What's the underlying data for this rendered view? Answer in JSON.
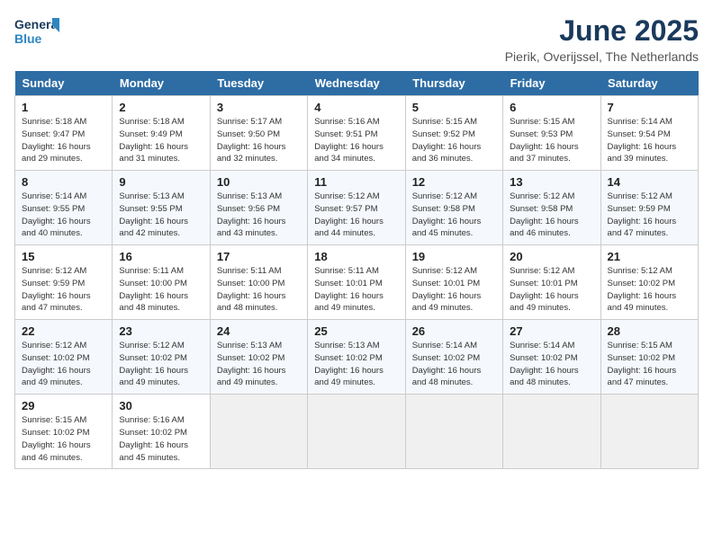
{
  "logo": {
    "line1": "General",
    "line2": "Blue"
  },
  "title": "June 2025",
  "subtitle": "Pierik, Overijssel, The Netherlands",
  "days_header": [
    "Sunday",
    "Monday",
    "Tuesday",
    "Wednesday",
    "Thursday",
    "Friday",
    "Saturday"
  ],
  "weeks": [
    [
      {
        "day": "1",
        "sunrise": "5:18 AM",
        "sunset": "9:47 PM",
        "daylight": "16 hours and 29 minutes."
      },
      {
        "day": "2",
        "sunrise": "5:18 AM",
        "sunset": "9:49 PM",
        "daylight": "16 hours and 31 minutes."
      },
      {
        "day": "3",
        "sunrise": "5:17 AM",
        "sunset": "9:50 PM",
        "daylight": "16 hours and 32 minutes."
      },
      {
        "day": "4",
        "sunrise": "5:16 AM",
        "sunset": "9:51 PM",
        "daylight": "16 hours and 34 minutes."
      },
      {
        "day": "5",
        "sunrise": "5:15 AM",
        "sunset": "9:52 PM",
        "daylight": "16 hours and 36 minutes."
      },
      {
        "day": "6",
        "sunrise": "5:15 AM",
        "sunset": "9:53 PM",
        "daylight": "16 hours and 37 minutes."
      },
      {
        "day": "7",
        "sunrise": "5:14 AM",
        "sunset": "9:54 PM",
        "daylight": "16 hours and 39 minutes."
      }
    ],
    [
      {
        "day": "8",
        "sunrise": "5:14 AM",
        "sunset": "9:55 PM",
        "daylight": "16 hours and 40 minutes."
      },
      {
        "day": "9",
        "sunrise": "5:13 AM",
        "sunset": "9:55 PM",
        "daylight": "16 hours and 42 minutes."
      },
      {
        "day": "10",
        "sunrise": "5:13 AM",
        "sunset": "9:56 PM",
        "daylight": "16 hours and 43 minutes."
      },
      {
        "day": "11",
        "sunrise": "5:12 AM",
        "sunset": "9:57 PM",
        "daylight": "16 hours and 44 minutes."
      },
      {
        "day": "12",
        "sunrise": "5:12 AM",
        "sunset": "9:58 PM",
        "daylight": "16 hours and 45 minutes."
      },
      {
        "day": "13",
        "sunrise": "5:12 AM",
        "sunset": "9:58 PM",
        "daylight": "16 hours and 46 minutes."
      },
      {
        "day": "14",
        "sunrise": "5:12 AM",
        "sunset": "9:59 PM",
        "daylight": "16 hours and 47 minutes."
      }
    ],
    [
      {
        "day": "15",
        "sunrise": "5:12 AM",
        "sunset": "9:59 PM",
        "daylight": "16 hours and 47 minutes."
      },
      {
        "day": "16",
        "sunrise": "5:11 AM",
        "sunset": "10:00 PM",
        "daylight": "16 hours and 48 minutes."
      },
      {
        "day": "17",
        "sunrise": "5:11 AM",
        "sunset": "10:00 PM",
        "daylight": "16 hours and 48 minutes."
      },
      {
        "day": "18",
        "sunrise": "5:11 AM",
        "sunset": "10:01 PM",
        "daylight": "16 hours and 49 minutes."
      },
      {
        "day": "19",
        "sunrise": "5:12 AM",
        "sunset": "10:01 PM",
        "daylight": "16 hours and 49 minutes."
      },
      {
        "day": "20",
        "sunrise": "5:12 AM",
        "sunset": "10:01 PM",
        "daylight": "16 hours and 49 minutes."
      },
      {
        "day": "21",
        "sunrise": "5:12 AM",
        "sunset": "10:02 PM",
        "daylight": "16 hours and 49 minutes."
      }
    ],
    [
      {
        "day": "22",
        "sunrise": "5:12 AM",
        "sunset": "10:02 PM",
        "daylight": "16 hours and 49 minutes."
      },
      {
        "day": "23",
        "sunrise": "5:12 AM",
        "sunset": "10:02 PM",
        "daylight": "16 hours and 49 minutes."
      },
      {
        "day": "24",
        "sunrise": "5:13 AM",
        "sunset": "10:02 PM",
        "daylight": "16 hours and 49 minutes."
      },
      {
        "day": "25",
        "sunrise": "5:13 AM",
        "sunset": "10:02 PM",
        "daylight": "16 hours and 49 minutes."
      },
      {
        "day": "26",
        "sunrise": "5:14 AM",
        "sunset": "10:02 PM",
        "daylight": "16 hours and 48 minutes."
      },
      {
        "day": "27",
        "sunrise": "5:14 AM",
        "sunset": "10:02 PM",
        "daylight": "16 hours and 48 minutes."
      },
      {
        "day": "28",
        "sunrise": "5:15 AM",
        "sunset": "10:02 PM",
        "daylight": "16 hours and 47 minutes."
      }
    ],
    [
      {
        "day": "29",
        "sunrise": "5:15 AM",
        "sunset": "10:02 PM",
        "daylight": "16 hours and 46 minutes."
      },
      {
        "day": "30",
        "sunrise": "5:16 AM",
        "sunset": "10:02 PM",
        "daylight": "16 hours and 45 minutes."
      },
      {
        "day": "",
        "sunrise": "",
        "sunset": "",
        "daylight": ""
      },
      {
        "day": "",
        "sunrise": "",
        "sunset": "",
        "daylight": ""
      },
      {
        "day": "",
        "sunrise": "",
        "sunset": "",
        "daylight": ""
      },
      {
        "day": "",
        "sunrise": "",
        "sunset": "",
        "daylight": ""
      },
      {
        "day": "",
        "sunrise": "",
        "sunset": "",
        "daylight": ""
      }
    ]
  ]
}
